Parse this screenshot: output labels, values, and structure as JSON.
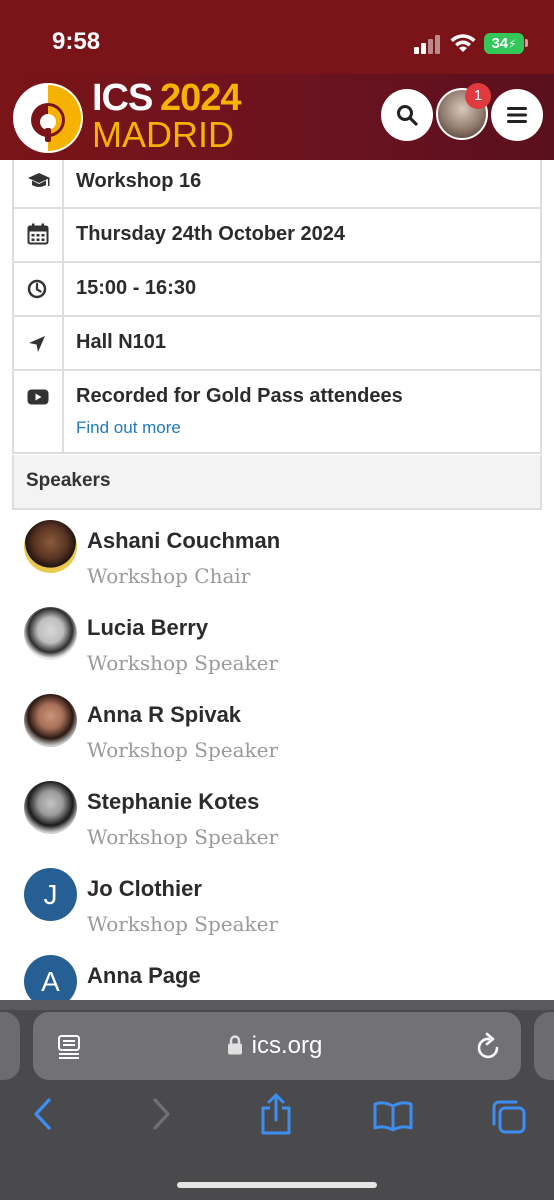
{
  "status_bar": {
    "time": "9:58",
    "battery": "34"
  },
  "header": {
    "logo_line1_a": "ICS",
    "logo_line1_b": "2024",
    "logo_line2": "MADRID",
    "notification_count": "1"
  },
  "session": {
    "rows": [
      {
        "icon": "graduation-cap-icon",
        "text": "Workshop 16"
      },
      {
        "icon": "calendar-icon",
        "text": "Thursday 24th October 2024"
      },
      {
        "icon": "clock-icon",
        "text": "15:00 - 16:30"
      },
      {
        "icon": "location-arrow-icon",
        "text": "Hall N101"
      },
      {
        "icon": "youtube-icon",
        "text": "Recorded for Gold Pass attendees",
        "link": "Find out more"
      }
    ]
  },
  "speakers": {
    "heading": "Speakers",
    "list": [
      {
        "name": "Ashani Couchman",
        "role": "Workshop Chair"
      },
      {
        "name": "Lucia Berry",
        "role": "Workshop Speaker"
      },
      {
        "name": "Anna R Spivak",
        "role": "Workshop Speaker"
      },
      {
        "name": "Stephanie Kotes",
        "role": "Workshop Speaker"
      },
      {
        "name": "Jo Clothier",
        "role": "Workshop Speaker",
        "initial": "J"
      },
      {
        "name": "Anna Page",
        "role": "",
        "initial": "A"
      }
    ]
  },
  "browser": {
    "url": "ics.org"
  },
  "colors": {
    "brand": "#7a1418",
    "accent_gold": "#f6b200",
    "link": "#1f7ab8",
    "ios_blue": "#3d8ef0"
  }
}
